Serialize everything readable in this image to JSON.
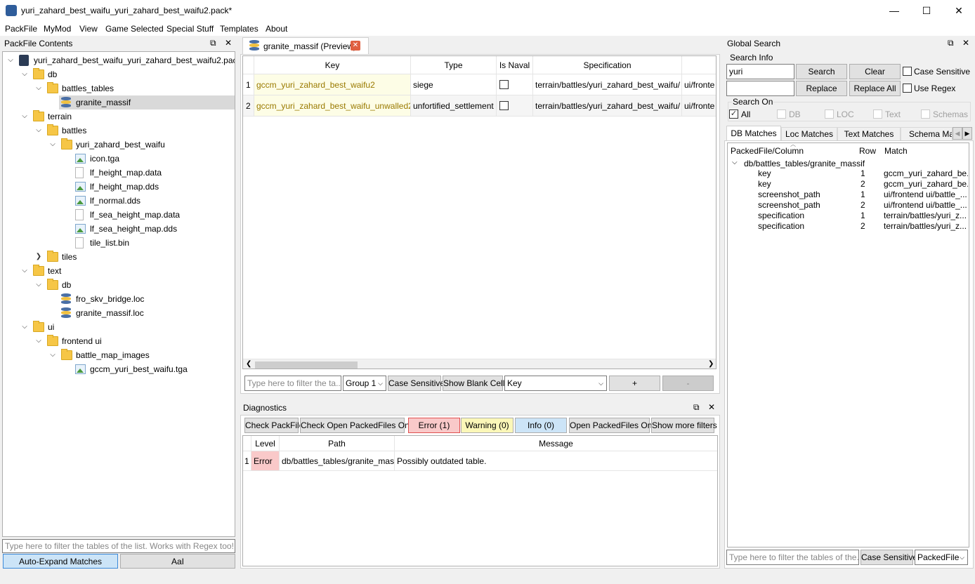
{
  "window": {
    "title": "yuri_zahard_best_waifu_yuri_zahard_best_waifu2.pack*",
    "min": "—",
    "max": "☐",
    "close": "✕"
  },
  "menu": [
    "PackFile",
    "MyMod",
    "View",
    "Game Selected",
    "Special Stuff",
    "Templates",
    "About"
  ],
  "packfile_panel": {
    "title": "PackFile Contents",
    "tree": [
      {
        "label": "yuri_zahard_best_waifu_yuri_zahard_best_waifu2.pack",
        "icon": "pack",
        "depth": 0,
        "chev": "down"
      },
      {
        "label": "db",
        "icon": "folder",
        "depth": 1,
        "chev": "down"
      },
      {
        "label": "battles_tables",
        "icon": "folder",
        "depth": 2,
        "chev": "down"
      },
      {
        "label": "granite_massif",
        "icon": "db",
        "depth": 3,
        "chev": "",
        "selected": true
      },
      {
        "label": "terrain",
        "icon": "folder",
        "depth": 1,
        "chev": "down"
      },
      {
        "label": "battles",
        "icon": "folder",
        "depth": 2,
        "chev": "down"
      },
      {
        "label": "yuri_zahard_best_waifu",
        "icon": "folder",
        "depth": 3,
        "chev": "down"
      },
      {
        "label": "icon.tga",
        "icon": "image",
        "depth": 4,
        "chev": ""
      },
      {
        "label": "lf_height_map.data",
        "icon": "doc",
        "depth": 4,
        "chev": ""
      },
      {
        "label": "lf_height_map.dds",
        "icon": "image",
        "depth": 4,
        "chev": ""
      },
      {
        "label": "lf_normal.dds",
        "icon": "image",
        "depth": 4,
        "chev": ""
      },
      {
        "label": "lf_sea_height_map.data",
        "icon": "doc",
        "depth": 4,
        "chev": ""
      },
      {
        "label": "lf_sea_height_map.dds",
        "icon": "image",
        "depth": 4,
        "chev": ""
      },
      {
        "label": "tile_list.bin",
        "icon": "doc",
        "depth": 4,
        "chev": ""
      },
      {
        "label": "tiles",
        "icon": "folder",
        "depth": 2,
        "chev": "right"
      },
      {
        "label": "text",
        "icon": "folder",
        "depth": 1,
        "chev": "down"
      },
      {
        "label": "db",
        "icon": "folder",
        "depth": 2,
        "chev": "down"
      },
      {
        "label": "fro_skv_bridge.loc",
        "icon": "db",
        "depth": 3,
        "chev": ""
      },
      {
        "label": "granite_massif.loc",
        "icon": "db",
        "depth": 3,
        "chev": ""
      },
      {
        "label": "ui",
        "icon": "folder",
        "depth": 1,
        "chev": "down"
      },
      {
        "label": "frontend ui",
        "icon": "folder",
        "depth": 2,
        "chev": "down"
      },
      {
        "label": "battle_map_images",
        "icon": "folder",
        "depth": 3,
        "chev": "down"
      },
      {
        "label": "gccm_yuri_best_waifu.tga",
        "icon": "image",
        "depth": 4,
        "chev": ""
      }
    ],
    "filter_placeholder": "Type here to filter the tables of the list. Works with Regex too!",
    "auto_expand": "Auto-Expand Matches",
    "aai": "AaI"
  },
  "editor": {
    "tab_label": "granite_massif (Preview)",
    "columns": [
      "Key",
      "Type",
      "Is Naval",
      "Specification",
      ""
    ],
    "rows": [
      {
        "n": "1",
        "key": "gccm_yuri_zahard_best_waifu2",
        "type": "siege",
        "spec": "terrain/battles/yuri_zahard_best_waifu/",
        "extra": "ui/fronte"
      },
      {
        "n": "2",
        "key": "gccm_yuri_zahard_best_waifu_unwalled2",
        "type": "unfortified_settlement",
        "spec": "terrain/battles/yuri_zahard_best_waifu/",
        "extra": "ui/fronte"
      }
    ],
    "filter_placeholder": "Type here to filter the ta...",
    "group": "Group 1",
    "case_sensitive": "Case Sensitive",
    "show_blank": "Show Blank Cells",
    "column_select": "Key",
    "plus": "+",
    "minus": "-"
  },
  "diagnostics": {
    "title": "Diagnostics",
    "check_packfile": "Check PackFile",
    "check_open": "Check Open PackedFiles Only",
    "error": "Error (1)",
    "warning": "Warning (0)",
    "info": "Info (0)",
    "open_only": "Open PackedFiles Only",
    "more_filters": "Show more filters",
    "columns": [
      "Level",
      "Path",
      "Message"
    ],
    "rows": [
      {
        "n": "1",
        "level": "Error",
        "path": "db/battles_tables/granite_massif",
        "message": "Possibly outdated table."
      }
    ],
    "colors": {
      "error": "#f9c9c9",
      "warning": "#fbf7b8",
      "info": "#cce4f7"
    }
  },
  "global_search": {
    "title": "Global Search",
    "search_info": "Search Info",
    "query": "yuri",
    "search": "Search",
    "clear": "Clear",
    "case_sensitive": "Case Sensitive",
    "replace": "Replace",
    "replace_all": "Replace All",
    "use_regex": "Use Regex",
    "search_on": "Search On",
    "targets": [
      "All",
      "DB",
      "LOC",
      "Text",
      "Schemas"
    ],
    "tabs": [
      "DB Matches",
      "Loc Matches",
      "Text Matches",
      "Schema Matc"
    ],
    "columns": [
      "PackedFile/Column",
      "Row",
      "Match"
    ],
    "group": "db/battles_tables/granite_massif",
    "matches": [
      {
        "col": "key",
        "row": "1",
        "match": "gccm_yuri_zahard_be..."
      },
      {
        "col": "key",
        "row": "2",
        "match": "gccm_yuri_zahard_be..."
      },
      {
        "col": "screenshot_path",
        "row": "1",
        "match": "ui/frontend ui/battle_..."
      },
      {
        "col": "screenshot_path",
        "row": "2",
        "match": "ui/frontend ui/battle_..."
      },
      {
        "col": "specification",
        "row": "1",
        "match": "terrain/battles/yuri_z..."
      },
      {
        "col": "specification",
        "row": "2",
        "match": "terrain/battles/yuri_z..."
      }
    ],
    "filter_placeholder": "Type here to filter the tables of the...",
    "case_btn": "Case Sensitive",
    "scope": "PackedFile"
  }
}
